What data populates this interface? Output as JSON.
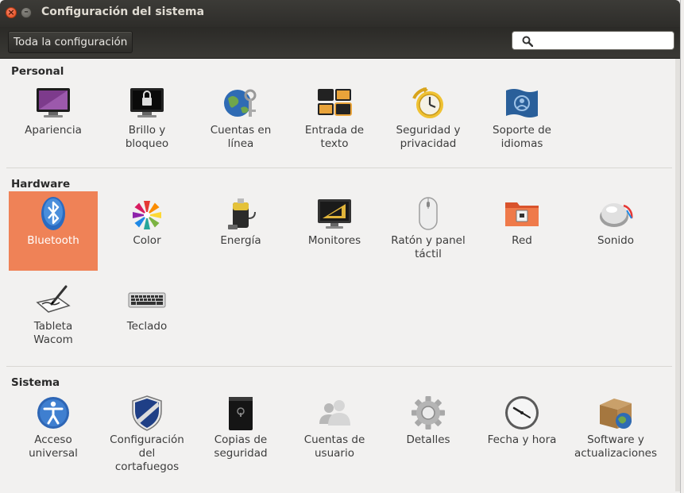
{
  "window": {
    "title": "Configuración del sistema"
  },
  "toolbar": {
    "all_settings_label": "Toda la configuración",
    "search_placeholder": "",
    "search_value": ""
  },
  "sections": {
    "personal": {
      "title": "Personal",
      "items": [
        {
          "label": "Apariencia",
          "icon": "appearance-icon"
        },
        {
          "label": "Brillo y\nbloqueo",
          "icon": "brightness-lock-icon"
        },
        {
          "label": "Cuentas en\nlínea",
          "icon": "online-accounts-icon"
        },
        {
          "label": "Entrada de\ntexto",
          "icon": "text-entry-icon"
        },
        {
          "label": "Seguridad y\nprivacidad",
          "icon": "security-privacy-icon"
        },
        {
          "label": "Soporte de\nidiomas",
          "icon": "language-support-icon"
        }
      ]
    },
    "hardware": {
      "title": "Hardware",
      "items": [
        {
          "label": "Bluetooth",
          "icon": "bluetooth-icon",
          "selected": true
        },
        {
          "label": "Color",
          "icon": "color-icon"
        },
        {
          "label": "Energía",
          "icon": "power-icon"
        },
        {
          "label": "Monitores",
          "icon": "monitors-icon"
        },
        {
          "label": "Ratón y panel\ntáctil",
          "icon": "mouse-touchpad-icon"
        },
        {
          "label": "Red",
          "icon": "network-icon"
        },
        {
          "label": "Sonido",
          "icon": "sound-icon"
        },
        {
          "label": "Tableta\nWacom",
          "icon": "wacom-tablet-icon"
        },
        {
          "label": "Teclado",
          "icon": "keyboard-icon"
        }
      ]
    },
    "system": {
      "title": "Sistema",
      "items": [
        {
          "label": "Acceso\nuniversal",
          "icon": "universal-access-icon"
        },
        {
          "label": "Configuración\ndel\ncortafuegos",
          "icon": "firewall-icon"
        },
        {
          "label": "Copias de\nseguridad",
          "icon": "backup-icon"
        },
        {
          "label": "Cuentas de\nusuario",
          "icon": "user-accounts-icon"
        },
        {
          "label": "Detalles",
          "icon": "details-icon"
        },
        {
          "label": "Fecha y hora",
          "icon": "date-time-icon"
        },
        {
          "label": "Software y\nactualizaciones",
          "icon": "software-updates-icon"
        }
      ]
    }
  },
  "colors": {
    "selection": "#ef8257",
    "titlebar": "#3c3b37",
    "background": "#f2f1f0"
  }
}
